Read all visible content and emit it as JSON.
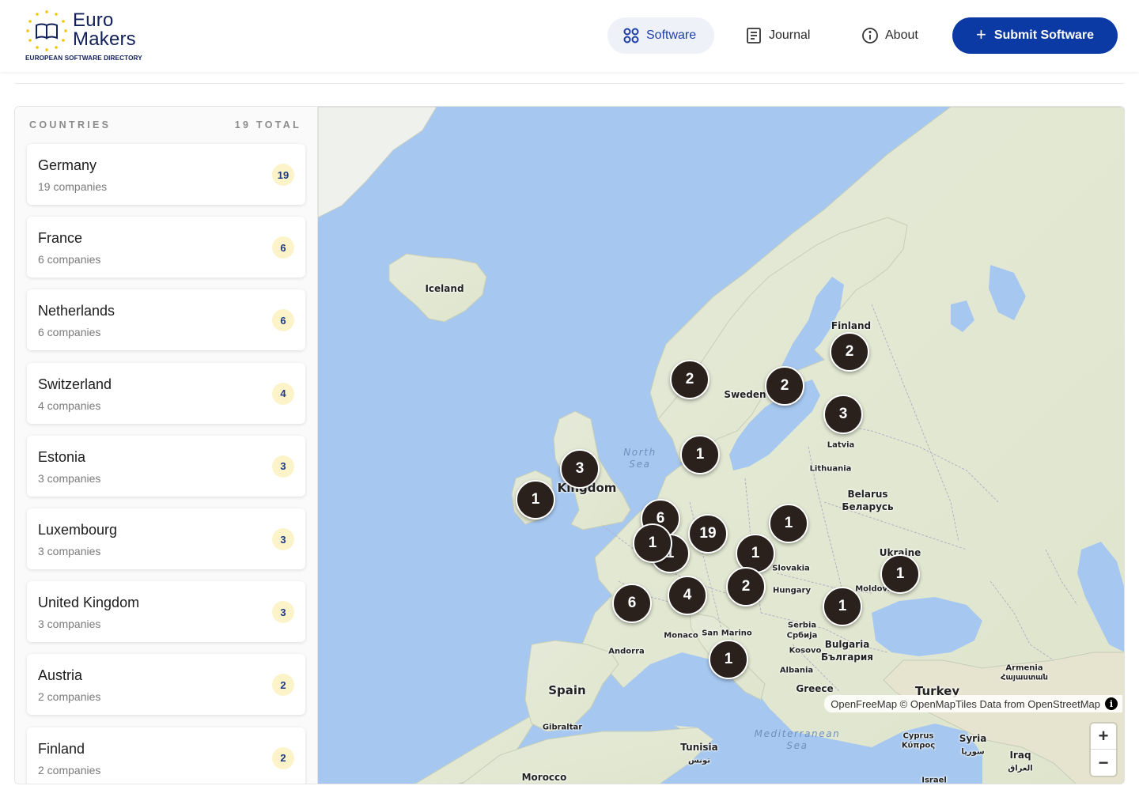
{
  "brand": {
    "name_line1": "Euro",
    "name_line2": "Makers",
    "tagline": "EUROPEAN SOFTWARE DIRECTORY"
  },
  "nav": {
    "software": "Software",
    "journal": "Journal",
    "about": "About",
    "submit": "Submit Software"
  },
  "sidebar": {
    "heading": "COUNTRIES",
    "total": "19 TOTAL",
    "countries": [
      {
        "name": "Germany",
        "sub": "19 companies",
        "count": "19"
      },
      {
        "name": "France",
        "sub": "6 companies",
        "count": "6"
      },
      {
        "name": "Netherlands",
        "sub": "6 companies",
        "count": "6"
      },
      {
        "name": "Switzerland",
        "sub": "4 companies",
        "count": "4"
      },
      {
        "name": "Estonia",
        "sub": "3 companies",
        "count": "3"
      },
      {
        "name": "Luxembourg",
        "sub": "3 companies",
        "count": "3"
      },
      {
        "name": "United Kingdom",
        "sub": "3 companies",
        "count": "3"
      },
      {
        "name": "Austria",
        "sub": "2 companies",
        "count": "2"
      },
      {
        "name": "Finland",
        "sub": "2 companies",
        "count": "2"
      }
    ]
  },
  "map": {
    "labels": {
      "iceland": "Iceland",
      "finland": "Finland",
      "sweden": "Sweden",
      "latvia": "Latvia",
      "lithuania": "Lithuania",
      "belarus": "Belarus",
      "belarus_local": "Беларусь",
      "ukraine": "Ukraine",
      "moldova": "Moldova",
      "slovakia": "Slovakia",
      "hungary": "Hungary",
      "serbia": "Serbia",
      "serbia_local": "Србија",
      "kosovo": "Kosovo",
      "bulgaria": "Bulgaria",
      "bulgaria_local": "България",
      "albania": "Albania",
      "greece": "Greece",
      "turkey": "Turkey",
      "armenia": "Armenia",
      "armenia_local": "Հայաստան",
      "monaco": "Monaco",
      "san_marino": "San Marino",
      "andorra": "Andorra",
      "spain": "Spain",
      "gibraltar": "Gibraltar",
      "morocco": "Morocco",
      "tunisia": "Tunisia",
      "tunisia_local": "تونس",
      "cyprus": "Cyprus",
      "cyprus_local": "Κύπρος",
      "syria": "Syria",
      "syria_local": "سوريا",
      "iraq": "Iraq",
      "iraq_local": "العراق",
      "israel": "Israel",
      "uk": "Kingdom",
      "north_sea": "North\nSea",
      "med_sea": "Mediterranean\nSea"
    },
    "clusters": [
      {
        "id": "norway",
        "count": "2"
      },
      {
        "id": "sweden",
        "count": "2"
      },
      {
        "id": "finland",
        "count": "2"
      },
      {
        "id": "estonia",
        "count": "3"
      },
      {
        "id": "denmark",
        "count": "1"
      },
      {
        "id": "uk",
        "count": "3"
      },
      {
        "id": "ireland",
        "count": "1"
      },
      {
        "id": "netherlands",
        "count": "6"
      },
      {
        "id": "belgium-a",
        "count": "1"
      },
      {
        "id": "belgium-b",
        "count": "1"
      },
      {
        "id": "germany",
        "count": "19"
      },
      {
        "id": "czechia",
        "count": "1"
      },
      {
        "id": "poland",
        "count": "1"
      },
      {
        "id": "austria",
        "count": "2"
      },
      {
        "id": "switzerland",
        "count": "4"
      },
      {
        "id": "france",
        "count": "6"
      },
      {
        "id": "italy",
        "count": "1"
      },
      {
        "id": "romania",
        "count": "1"
      },
      {
        "id": "ukraine",
        "count": "1"
      }
    ],
    "attribution": "OpenFreeMap © OpenMapTiles Data from OpenStreetMap",
    "zoom_in": "+",
    "zoom_out": "−"
  },
  "colors": {
    "primary": "#0b3aa4",
    "brand_text": "#12205a",
    "badge_bg": "#fdf3c8",
    "badge_text": "#1e3a8a",
    "cluster_bg": "#2a211d",
    "water": "#a6c8f0",
    "land": "#dfe8cf"
  }
}
